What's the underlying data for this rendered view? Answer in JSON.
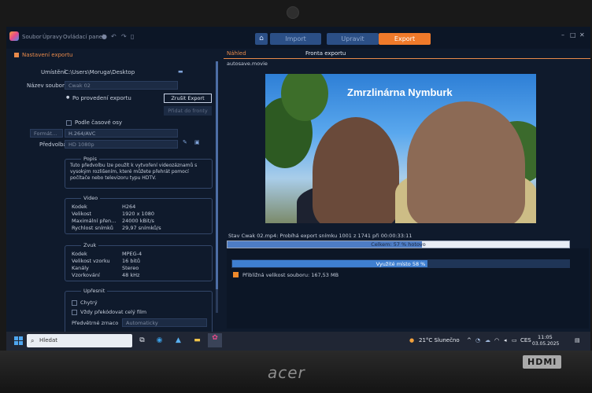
{
  "menubar": {
    "items": [
      "Soubor",
      "Úpravy",
      "Ovládací panel"
    ],
    "nav": {
      "import": "Import",
      "edit": "Upravit",
      "export": "Export"
    },
    "window_controls": [
      "–",
      "□",
      "✕"
    ]
  },
  "left_panel": {
    "section_title": "Nastavení exportu",
    "location_label": "Umístění",
    "location_value": "C:\\Users\\Moruga\\Desktop",
    "filename_label": "Název souboru",
    "filename_value": "Cwak 02",
    "after_export_label": "Po provedení exportu",
    "cancel_export_button": "Zrušit Export",
    "add_to_queue_button": "Přidat do fronty",
    "time_axis_label": "Podle časové osy",
    "format_value": "Formát…",
    "codec_value": "H.264/AVC",
    "preset_label": "Předvolba",
    "preset_value": "HD 1080p",
    "description_title": "Popis",
    "description_text": "Tuto předvolbu lze použít k vytvoření videozáznamů s vysokým rozlišením, které můžete přehrát pomocí počítače nebo televizoru typu HDTV.",
    "video_title": "Video",
    "video_rows": [
      {
        "key": "Kodek",
        "value": "H264"
      },
      {
        "key": "Velikost",
        "value": "1920 x 1080"
      },
      {
        "key": "Maximální přen…",
        "value": "24000 kBit/s"
      },
      {
        "key": "Rychlost snímků",
        "value": "29,97 snímků/s"
      }
    ],
    "audio_title": "Zvuk",
    "audio_rows": [
      {
        "key": "Kodek",
        "value": "MPEG-4"
      },
      {
        "key": "Velikost vzorku",
        "value": "16 bitů"
      },
      {
        "key": "Kanály",
        "value": "Stereo"
      },
      {
        "key": "Vzorkování",
        "value": "48 kHz"
      }
    ],
    "refine_title": "Upřesnit",
    "smart_label": "Chytrý",
    "recode_label": "Vždy překódovat celý film",
    "sharp_label": "Předvětrné zrnaco",
    "sharp_value": "Automaticky"
  },
  "right_panel": {
    "tab_preview": "Náhled",
    "tab_queue": "Fronta exportu",
    "autosave_file": "autosave.movie",
    "overlay_title": "Zmrzlinárna Nymburk",
    "status_line": "Stav Cwak 02.mp4: Probíhá export snímku 1001 z 1741 při 00:00:33:11",
    "total_label": "Celkem: 57 % hotovo",
    "total_progress": 0.57,
    "space_label": "Využité místo 58 %",
    "space_progress": 0.58,
    "size_label": "Přibližná velikost souboru: 167,53 MB",
    "size_color": "#f08a2c"
  },
  "taskbar": {
    "search_placeholder": "Hledat",
    "weather": "21°C Slunečno",
    "language": "CES",
    "time": "11:05",
    "date": "03.05.2025"
  }
}
